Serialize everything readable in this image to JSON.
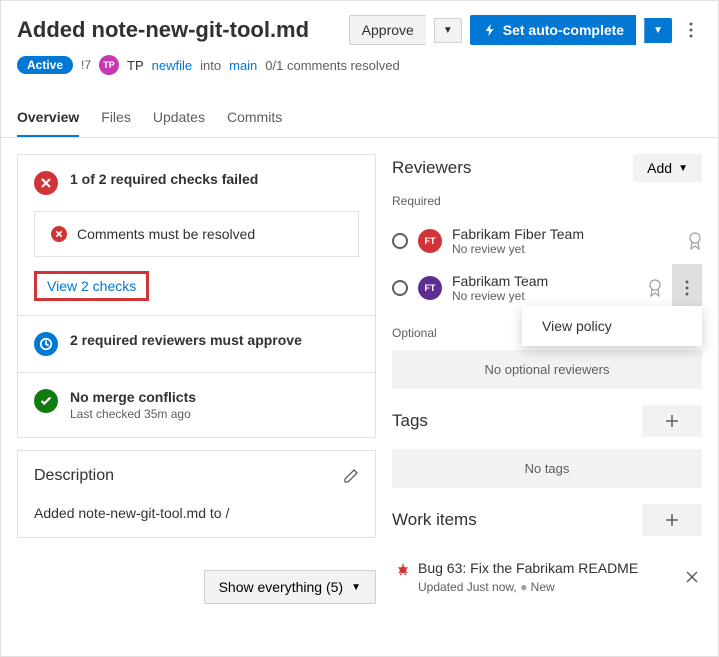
{
  "header": {
    "title": "Added note-new-git-tool.md",
    "approve": "Approve",
    "autocomplete": "Set auto-complete"
  },
  "meta": {
    "status": "Active",
    "pr_id": "!7",
    "avatar_initials": "TP",
    "author": "TP",
    "source_branch": "newfile",
    "into": "into",
    "target_branch": "main",
    "comments": "0/1 comments resolved"
  },
  "tabs": [
    "Overview",
    "Files",
    "Updates",
    "Commits"
  ],
  "checks": {
    "summary": "1 of 2 required checks failed",
    "items": [
      "Comments must be resolved"
    ],
    "view_link": "View 2 checks"
  },
  "reviewers_block": {
    "text": "2 required reviewers must approve"
  },
  "merge": {
    "text": "No merge conflicts",
    "sub": "Last checked 35m ago"
  },
  "description": {
    "title": "Description",
    "body": "Added note-new-git-tool.md to /"
  },
  "show_everything": "Show everything (5)",
  "reviewers": {
    "title": "Reviewers",
    "add": "Add",
    "required_label": "Required",
    "optional_label": "Optional",
    "list": [
      {
        "initials": "FT",
        "name": "Fabrikam Fiber Team",
        "status": "No review yet",
        "color": "rev-red"
      },
      {
        "initials": "FT",
        "name": "Fabrikam Team",
        "status": "No review yet",
        "color": "rev-purple"
      }
    ],
    "no_optional": "No optional reviewers",
    "popup": "View policy"
  },
  "tags": {
    "title": "Tags",
    "empty": "No tags"
  },
  "work_items": {
    "title": "Work items",
    "item": {
      "title": "Bug 63: Fix the Fabrikam README",
      "updated": "Updated Just now,",
      "state": "New"
    }
  }
}
